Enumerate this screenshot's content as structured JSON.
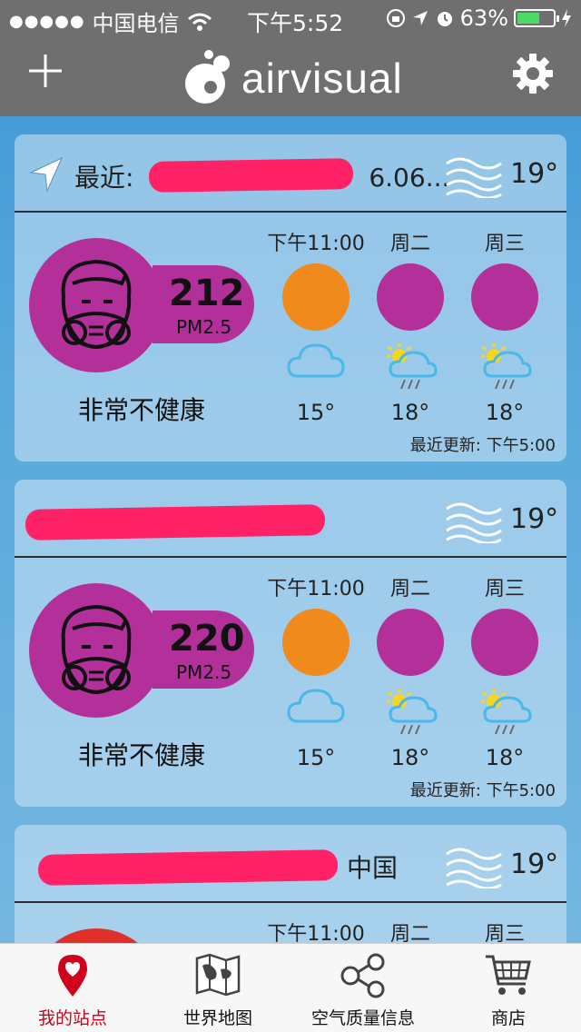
{
  "status_bar": {
    "carrier": "中国电信",
    "time": "下午5:52",
    "battery": "63%",
    "battery_level": 0.63
  },
  "header": {
    "logo_text": "airvisual",
    "add_icon": "plus-icon",
    "settings_icon": "gear-icon"
  },
  "cards": [
    {
      "location": "最近: ",
      "location_tail": "6.06...",
      "temp": "19°",
      "aqi": "212",
      "aqi_unit": "PM2.5",
      "aqi_label": "非常不健康",
      "aqi_color": "#b3309a",
      "forecast": [
        {
          "time": "下午11:00",
          "color": "#f08a1c",
          "weather": "cloud",
          "temp": "15°"
        },
        {
          "time": "周二",
          "color": "#b3309a",
          "weather": "sun-rain",
          "temp": "18°"
        },
        {
          "time": "周三",
          "color": "#b3309a",
          "weather": "sun-rain",
          "temp": "18°"
        }
      ],
      "updated": "最近更新: 下午5:00"
    },
    {
      "location": "",
      "temp": "19°",
      "aqi": "220",
      "aqi_unit": "PM2.5",
      "aqi_label": "非常不健康",
      "aqi_color": "#b3309a",
      "forecast": [
        {
          "time": "下午11:00",
          "color": "#f08a1c",
          "weather": "cloud",
          "temp": "15°"
        },
        {
          "time": "周二",
          "color": "#b3309a",
          "weather": "sun-rain",
          "temp": "18°"
        },
        {
          "time": "周三",
          "color": "#b3309a",
          "weather": "sun-rain",
          "temp": "18°"
        }
      ],
      "updated": "最近更新: 下午5:00"
    },
    {
      "location": "中国",
      "temp": "19°",
      "forecast": [
        {
          "time": "下午11:00"
        },
        {
          "time": "周二"
        },
        {
          "time": "周三"
        }
      ]
    }
  ],
  "tabs": [
    {
      "label": "我的站点",
      "icon": "heart-pin-icon",
      "active": true
    },
    {
      "label": "世界地图",
      "icon": "map-icon",
      "active": false
    },
    {
      "label": "空气质量信息",
      "icon": "share-nodes-icon",
      "active": false
    },
    {
      "label": "商店",
      "icon": "cart-icon",
      "active": false
    }
  ],
  "colors": {
    "accent_red": "#d0021b",
    "aqi_purple": "#b3309a",
    "aqi_orange": "#f08a1c",
    "header_gray": "#6f6f6f"
  }
}
